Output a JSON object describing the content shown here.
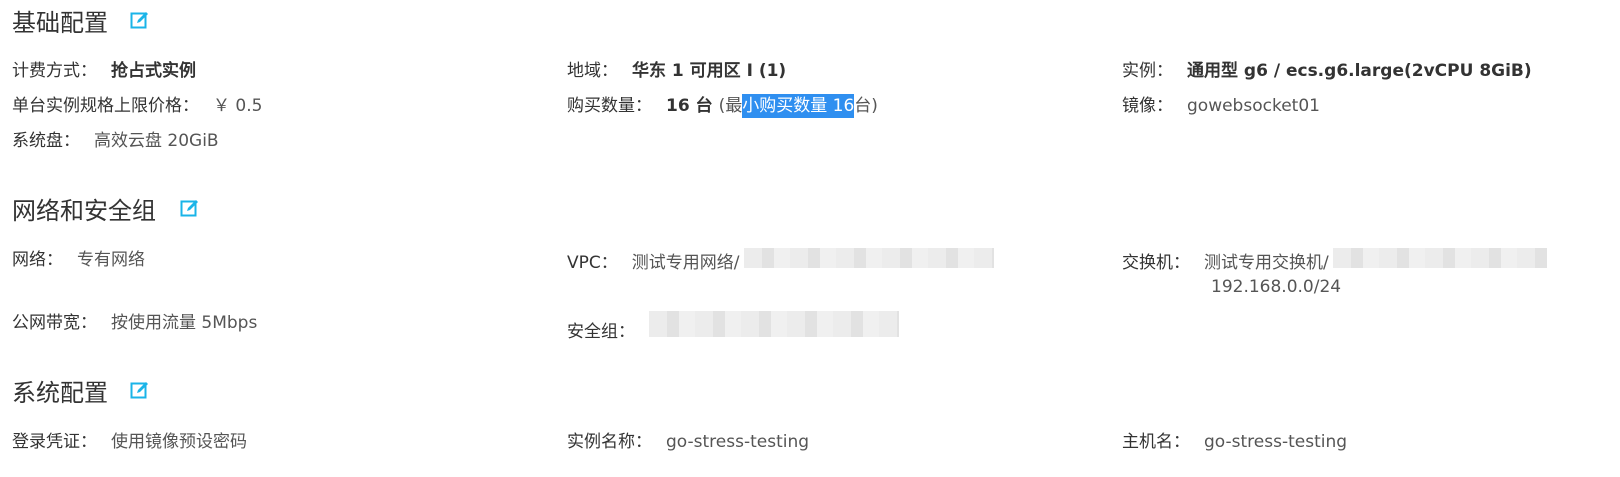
{
  "sections": {
    "basic": {
      "title": "基础配置",
      "fields": {
        "billing": {
          "label": "计费方式：",
          "value": "抢占式实例"
        },
        "region": {
          "label": "地域：",
          "value": "华东 1 可用区 I (1)"
        },
        "instance": {
          "label": "实例：",
          "value": "通用型 g6 / ecs.g6.large(2vCPU 8GiB)"
        },
        "max_price": {
          "label": "单台实例规格上限价格：",
          "value": "￥ 0.5"
        },
        "quantity": {
          "label": "购买数量：",
          "value_main": "16 台",
          "paren_open": "(最",
          "highlighted": "小购买数量 16 ",
          "paren_close": "台)"
        },
        "image": {
          "label": "镜像：",
          "value": "gowebsocket01"
        },
        "system_disk": {
          "label": "系统盘：",
          "value": "高效云盘 20GiB"
        }
      }
    },
    "network": {
      "title": "网络和安全组",
      "fields": {
        "network": {
          "label": "网络：",
          "value": "专有网络"
        },
        "vpc": {
          "label": "VPC：",
          "value": "测试专用网络/"
        },
        "vswitch": {
          "label": "交换机：",
          "value": "测试专用交换机/",
          "cidr": "192.168.0.0/24"
        },
        "bandwidth": {
          "label": "公网带宽：",
          "value": "按使用流量 5Mbps"
        },
        "security_group": {
          "label": "安全组：",
          "value": ""
        }
      }
    },
    "system": {
      "title": "系统配置",
      "fields": {
        "login": {
          "label": "登录凭证：",
          "value": "使用镜像预设密码"
        },
        "instance_name": {
          "label": "实例名称：",
          "value": "go-stress-testing"
        },
        "hostname": {
          "label": "主机名：",
          "value": "go-stress-testing"
        }
      }
    }
  },
  "icons": {
    "edit": "edit-icon"
  },
  "colors": {
    "accent": "#1ab4e8",
    "selection": "#2f8ff0"
  }
}
